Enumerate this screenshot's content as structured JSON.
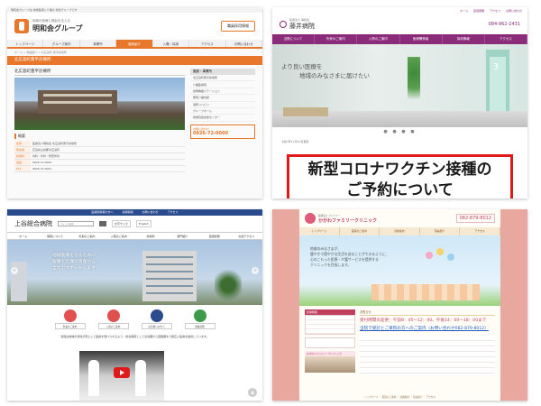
{
  "panel1": {
    "topbar": "明和会グループは 地域医療と介護の 総合グループです",
    "logo_sub": "地域の医療と福祉を支える",
    "logo_name": "明和会グループ",
    "header_button": "職員採用情報",
    "nav": [
      "トップページ",
      "グループ案内",
      "事業所",
      "施設紹介",
      "入職・採用",
      "アクセス",
      "お問い合わせ"
    ],
    "breadcrumb": "ホーム > 施設紹介 > 北広島町 豊平診療所",
    "page_heading": "北広島町豊平診療所",
    "section_title": "北広島町豊平診療所",
    "overview_heading": "概要",
    "table": [
      {
        "k": "名称",
        "v": "医療法人明和会 北広島町豊平診療所"
      },
      {
        "k": "所在地",
        "v": "広島県山県郡北広島町"
      },
      {
        "k": "診療科",
        "v": "内科・外科・整形外科"
      },
      {
        "k": "電話",
        "v": "0826-72-0000"
      },
      {
        "k": "FAX",
        "v": "0826-72-0001"
      }
    ],
    "side_title": "施設・事業所",
    "side_items": [
      "北広島町豊平診療所",
      "介護医療院",
      "訪問看護ステーション",
      "居宅介護支援",
      "通所リハビリ",
      "グループホーム",
      "地域包括支援センター"
    ],
    "phone_label": "お問い合わせ",
    "phone_number": "0826-72-0000"
  },
  "panel2": {
    "top_links": [
      "ホーム",
      "医院概要",
      "アクセス",
      "お問い合わせ"
    ],
    "name_sub": "医療法人 静和会",
    "name": "藤井病院",
    "tel": "084-962-2431",
    "nav": [
      "当院について",
      "外来のご案内",
      "入院のご案内",
      "医療関係者",
      "採用情報",
      "アクセス"
    ],
    "hero_line1": "より良い医療を",
    "hero_line2": "地域のみなさまに届けたい",
    "hero_room_number": "3",
    "slider_dots": "● ● ● ●",
    "news_date": "令和3年11月15日更新",
    "notice_line1": "新型コロナワクチン接種の",
    "notice_line2": "ご予約について"
  },
  "panel3": {
    "top_links": [
      "医療関係者の方へ",
      "採用情報",
      "お問い合わせ",
      "アクセス"
    ],
    "name": "上谷総合病院",
    "search_placeholder": "サイト内検索",
    "header_buttons": [
      "文字サイズ",
      "English"
    ],
    "nav": [
      "ホーム",
      "病院について",
      "外来のご案内",
      "入院のご案内",
      "診療科",
      "部門紹介",
      "健康診断",
      "交通アクセス"
    ],
    "hero_copy": [
      "地域医療を守るために",
      "医療と介護の両面から",
      "全力でサポートします"
    ],
    "icons": [
      {
        "label": "外来のご案内",
        "color": "#e05050"
      },
      {
        "label": "入院のご案内",
        "color": "#e05050"
      },
      {
        "label": "お見舞いの方へ",
        "color": "#2b4c8c"
      },
      {
        "label": "健康診断",
        "color": "#3c9a4a"
      }
    ],
    "intro_text": "当院は地域の皆様が安心して医療を受けられるよう、総合病院として急性期から回復期まで幅広い医療を提供しています。",
    "scroll_top": "▲"
  },
  "panel4": {
    "name_sub": "医療法人 ファミリー",
    "name": "かがわファミリークリニック",
    "tel": "082-879-8012",
    "nav": [
      "トップページ",
      "医院のご案内",
      "診療案内",
      "院長紹介",
      "アクセス"
    ],
    "hero_msg": [
      "地域のみなさまが、",
      "健やかで穏やかな生活を送ることができるように、",
      "心のこもった医療・介護サービスを提供する",
      "クリニックを目指します。"
    ],
    "schedule_title": "診療時間",
    "clinic_title": "かがわファミリークリニック",
    "news_title": "お知らせ",
    "news1": "受付時間の変更：午前8：45～12：00、午後14：00～18：00まで",
    "news2": "当院で受診とご来院の方へのご案内（お問い合わせ082-879-8012）",
    "footer": "トップページ ｜ 医院のご案内 ｜ 診療案内 ｜ 院長紹介 ｜ アクセス"
  },
  "colors": {
    "panel1_accent": "#e8772b",
    "panel2_accent": "#8a2c7a",
    "panel2_notice_border": "#e01a1a",
    "panel3_accent": "#2b4c8c",
    "panel4_accent": "#c03f5f",
    "panel4_background": "#e8a8a0"
  }
}
